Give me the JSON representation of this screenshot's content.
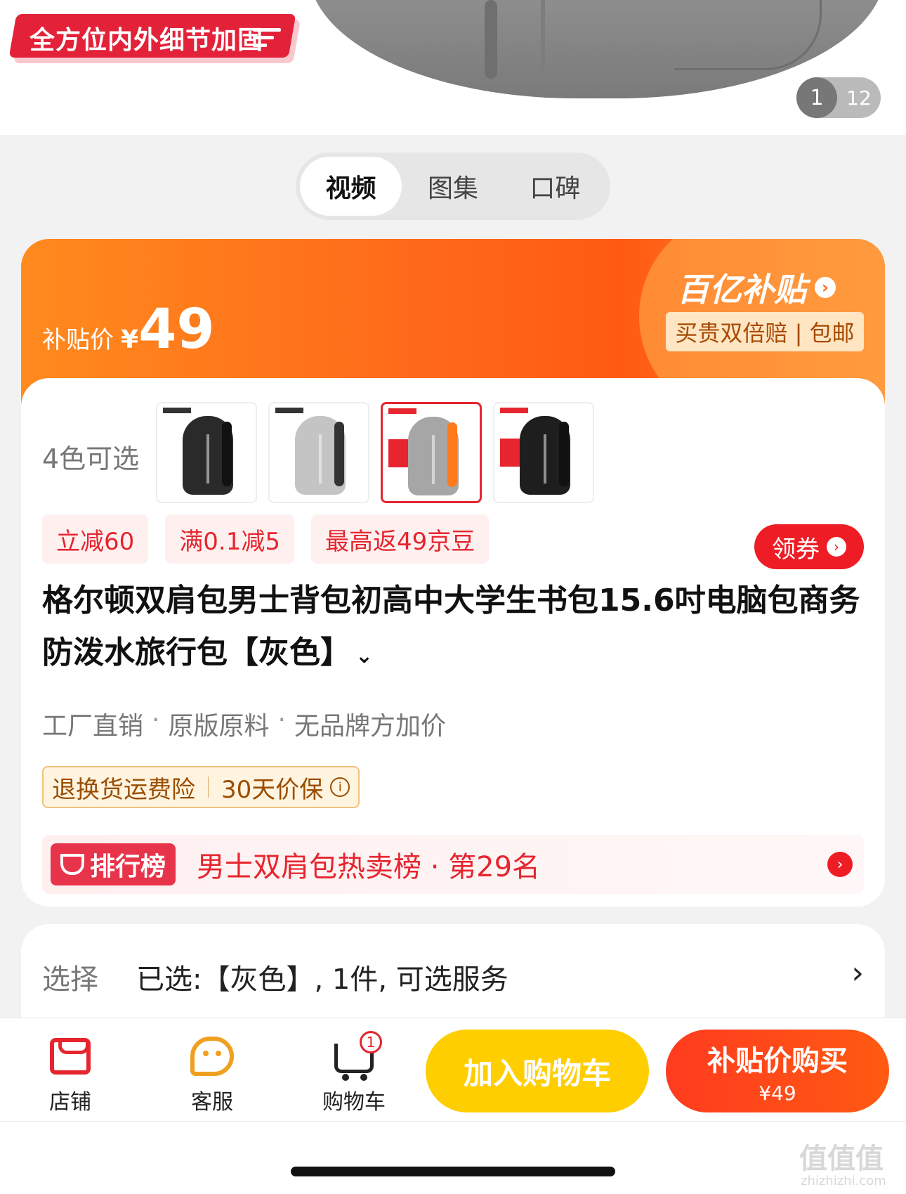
{
  "hero": {
    "banner_text": "全方位内外细节加固",
    "counter_current": "1",
    "counter_total": "12"
  },
  "media_tabs": [
    {
      "label": "视频",
      "active": true
    },
    {
      "label": "图集",
      "active": false
    },
    {
      "label": "口碑",
      "active": false
    }
  ],
  "price": {
    "label": "补贴价",
    "currency": "¥",
    "amount": "49",
    "brand": "百亿补贴",
    "brand_tag": "买贵双倍赔 | 包邮"
  },
  "colors": {
    "label": "4色可选",
    "options": [
      {
        "name": "black-accessory",
        "color": "#2a2a2a"
      },
      {
        "name": "light-grey",
        "color": "#b9b9b9"
      },
      {
        "name": "grey",
        "color": "#9c9c9c",
        "selected": true
      },
      {
        "name": "black",
        "color": "#1e1e1e"
      }
    ]
  },
  "promos": [
    "立减60",
    "满0.1减5",
    "最高返49京豆"
  ],
  "coupon_label": "领券",
  "title": "格尔顿双肩包男士背包初高中大学生书包15.6吋电脑包商务防泼水旅行包【灰色】",
  "features": [
    "工厂直销",
    "原版原料",
    "无品牌方加价"
  ],
  "service_tag": {
    "left": "退换货运费险",
    "right": "30天价保"
  },
  "ranking": {
    "badge": "排行榜",
    "text": "男士双肩包热卖榜 · 第29名"
  },
  "select": {
    "label": "选择",
    "value": "已选:【灰色】, 1件, 可选服务"
  },
  "bottom_bar": {
    "shop_label": "店铺",
    "service_label": "客服",
    "cart_label": "购物车",
    "cart_count": "1",
    "add_to_cart": "加入购物车",
    "buy_label": "补贴价购买",
    "buy_price": "¥49"
  },
  "watermark": {
    "main": "值值值",
    "sub": "zhizhizhi.com"
  }
}
